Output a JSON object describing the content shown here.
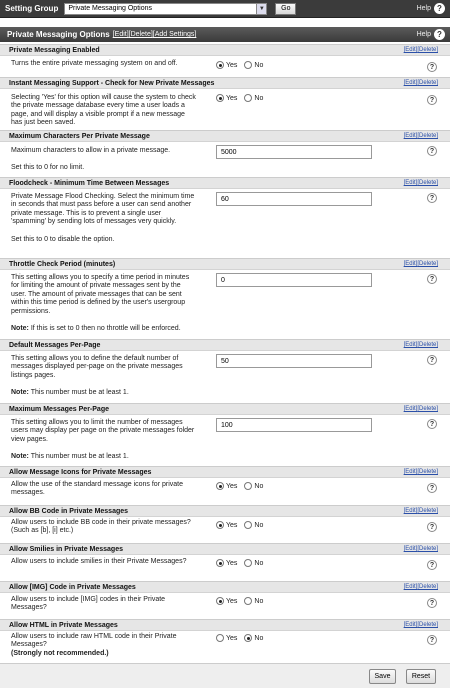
{
  "topbar": {
    "label": "Setting Group",
    "selected": "Private Messaging Options",
    "go": "Go",
    "help": "Help"
  },
  "group": {
    "title": "Private Messaging Options",
    "edit": "[Edit]",
    "delete": "[Delete]",
    "add": "[Add Settings]",
    "help": "Help"
  },
  "row_links": {
    "edit": "[Edit]",
    "delete": "[Delete]"
  },
  "radio_labels": {
    "yes": "Yes",
    "no": "No"
  },
  "settings": [
    {
      "title": "Private Messaging Enabled",
      "desc": "Turns the entire private messaging system on and off.",
      "note": "",
      "type": "radio",
      "value": "yes"
    },
    {
      "title": "Instant Messaging Support - Check for New Private Messages",
      "desc": "Selecting 'Yes' for this option will cause the system to check the private message database every time a user loads a page, and will display a visible prompt if a new message has just been saved.",
      "note": "",
      "type": "radio",
      "value": "yes"
    },
    {
      "title": "Maximum Characters Per Private Message",
      "desc": "Maximum characters to allow in a private message.",
      "note": "Set this to 0 for no limit.",
      "type": "text",
      "value": "5000"
    },
    {
      "title": "Floodcheck - Minimum Time Between Messages",
      "desc": "Private Message Flood Checking. Select the minimum time in seconds that must pass before a user can send another private message. This is to prevent a single user 'spamming' by sending lots of messages very quickly.",
      "note": "Set this to 0 to disable the option.",
      "type": "text",
      "value": "60"
    },
    {
      "title": "Throttle Check Period (minutes)",
      "desc": "This setting allows you to specify a time period in minutes for limiting the amount of private messages sent by the user. The amount of private messages that can be sent within this time period is defined by the user's usergroup permissions.",
      "note": "If this is set to 0 then no throttle will be enforced.",
      "note_bold": "Note:",
      "type": "text",
      "value": "0"
    },
    {
      "title": "Default Messages Per-Page",
      "desc": "This setting allows you to define the default number of messages displayed per-page on the private messages listings pages.",
      "note": "This number must be at least 1.",
      "note_bold": "Note:",
      "type": "text",
      "value": "50"
    },
    {
      "title": "Maximum Messages Per-Page",
      "desc": "This setting allows you to limit the number of messages users may display per page on the private messages folder view pages.",
      "note": "This number must be at least 1.",
      "note_bold": "Note:",
      "type": "text",
      "value": "100"
    },
    {
      "title": "Allow Message Icons for Private Messages",
      "desc": "Allow the use of the standard message icons for private messages.",
      "note": "",
      "type": "radio",
      "value": "yes"
    },
    {
      "title": "Allow BB Code in Private Messages",
      "desc": "Allow users to include BB code in their private messages? (Such as [b], [i] etc.)",
      "note": "",
      "type": "radio",
      "value": "yes"
    },
    {
      "title": "Allow Smilies in Private Messages",
      "desc": "Allow users to include smilies in their Private Messages?",
      "note": "",
      "type": "radio",
      "value": "yes"
    },
    {
      "title": "Allow [IMG] Code in Private Messages",
      "desc": "Allow users to include [IMG] codes in their Private Messages?",
      "note": "",
      "type": "radio",
      "value": "yes"
    },
    {
      "title": "Allow HTML in Private Messages",
      "desc": "Allow users to include raw HTML code in their Private Messages?",
      "desc_bold": "(Strongly not recommended.)",
      "note": "",
      "type": "radio",
      "value": "no"
    }
  ],
  "footer": {
    "save": "Save",
    "reset": "Reset"
  }
}
